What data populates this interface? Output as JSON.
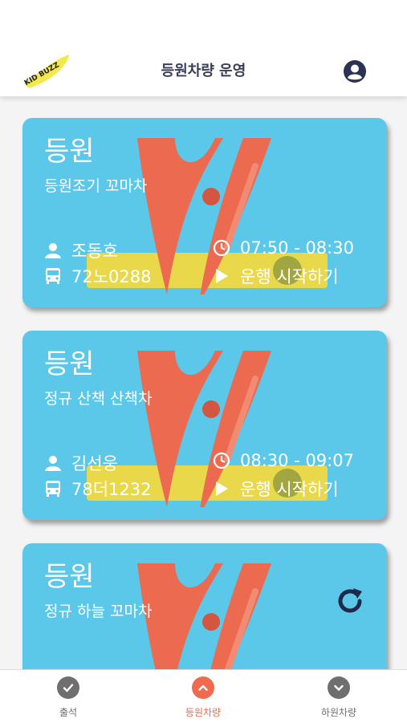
{
  "header": {
    "title": "등원차량 운영",
    "logo_text": "KID BUZZ"
  },
  "cards": [
    {
      "heading": "등원",
      "route": "등원조기 꼬마차",
      "driver": "조동호",
      "time": "07:50 - 08:30",
      "plate": "72노0288",
      "action": "운행 시작하기"
    },
    {
      "heading": "등원",
      "route": "정규 산책 산책차",
      "driver": "김선웅",
      "time": "08:30 - 09:07",
      "plate": "78더1232",
      "action": "운행 시작하기"
    },
    {
      "heading": "등원",
      "route": "정규 하늘 꼬마차"
    }
  ],
  "tabs": [
    {
      "label": "출석",
      "icon": "check-icon",
      "color": "#6f6f6f"
    },
    {
      "label": "등원차량",
      "icon": "chevron-up-icon",
      "color": "#f06a4f"
    },
    {
      "label": "하원차량",
      "icon": "chevron-down-icon",
      "color": "#6f6f6f"
    }
  ],
  "colors": {
    "card": "#5bc8e9",
    "accent": "#f06a4f",
    "title": "#3a3f57"
  }
}
